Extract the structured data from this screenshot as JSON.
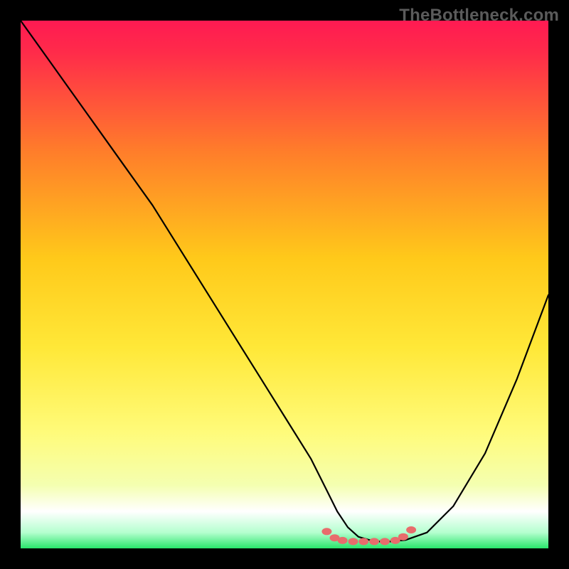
{
  "watermark": "TheBottleneck.com",
  "colors": {
    "page_bg": "#000000",
    "watermark": "#5b5b5b",
    "curve": "#000000",
    "band": "#ffffff",
    "marker": "#e86c6c",
    "gradient_top": "#ff1a52",
    "gradient_mid1": "#ffb000",
    "gradient_mid2": "#ffe800",
    "gradient_low": "#f6ffb0",
    "gradient_bottom": "#29e56b"
  },
  "chart_data": {
    "type": "line",
    "title": "",
    "xlabel": "",
    "ylabel": "",
    "xlim": [
      0,
      100
    ],
    "ylim": [
      0,
      100
    ],
    "x": [
      0,
      5,
      10,
      15,
      20,
      25,
      30,
      35,
      40,
      45,
      50,
      55,
      58,
      60,
      62,
      64,
      66,
      68,
      70,
      73,
      77,
      82,
      88,
      94,
      100
    ],
    "y": [
      100,
      93,
      86,
      79,
      72,
      65,
      57,
      49,
      41,
      33,
      25,
      17,
      11,
      7,
      4,
      2.2,
      1.6,
      1.3,
      1.3,
      1.6,
      3,
      8,
      18,
      32,
      48
    ],
    "flat_band": {
      "x_start": 58,
      "x_end": 73,
      "y": 1.3
    },
    "markers": [
      {
        "x": 58.0,
        "y": 3.2
      },
      {
        "x": 59.5,
        "y": 2.0
      },
      {
        "x": 61.0,
        "y": 1.5
      },
      {
        "x": 63.0,
        "y": 1.3
      },
      {
        "x": 65.0,
        "y": 1.3
      },
      {
        "x": 67.0,
        "y": 1.3
      },
      {
        "x": 69.0,
        "y": 1.3
      },
      {
        "x": 71.0,
        "y": 1.5
      },
      {
        "x": 72.5,
        "y": 2.2
      },
      {
        "x": 74.0,
        "y": 3.5
      }
    ]
  }
}
